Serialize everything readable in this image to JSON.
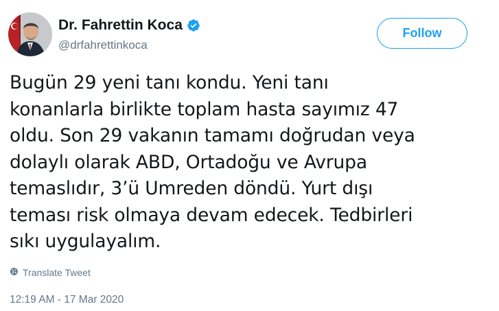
{
  "author": {
    "name": "Dr. Fahrettin Koca",
    "handle": "@drfahrettinkoca",
    "verified": true,
    "avatar_icon": "profile-photo"
  },
  "actions": {
    "follow_label": "Follow"
  },
  "tweet": {
    "text": "Bugün 29 yeni tanı kondu. Yeni tanı konanlarla birlikte toplam hasta sayımız 47 oldu. Son 29 vakanın tamamı doğrudan veya dolaylı olarak ABD, Ortadoğu ve Avrupa temaslıdır, 3’ü Umreden döndü. Yurt dışı teması risk olmaya devam edecek. Tedbirleri sıkı uygulayalım.",
    "lines": [
      "Bugün 29 yeni tanı kondu. Yeni tanı",
      "konanlarla birlikte toplam hasta sayımız 47",
      "oldu. Son 29 vakanın tamamı doğrudan veya",
      "dolaylı olarak ABD, Ortadoğu ve Avrupa",
      "temaslıdır, 3’ü Umreden döndü. Yurt dışı",
      "teması risk olmaya devam edecek. Tedbirleri",
      "sıkı uygulayalım."
    ],
    "translate_label": "Translate Tweet",
    "timestamp": "12:19 AM - 17 Mar 2020"
  },
  "colors": {
    "accent": "#1da1f2",
    "text": "#14171a",
    "secondary": "#657786"
  }
}
